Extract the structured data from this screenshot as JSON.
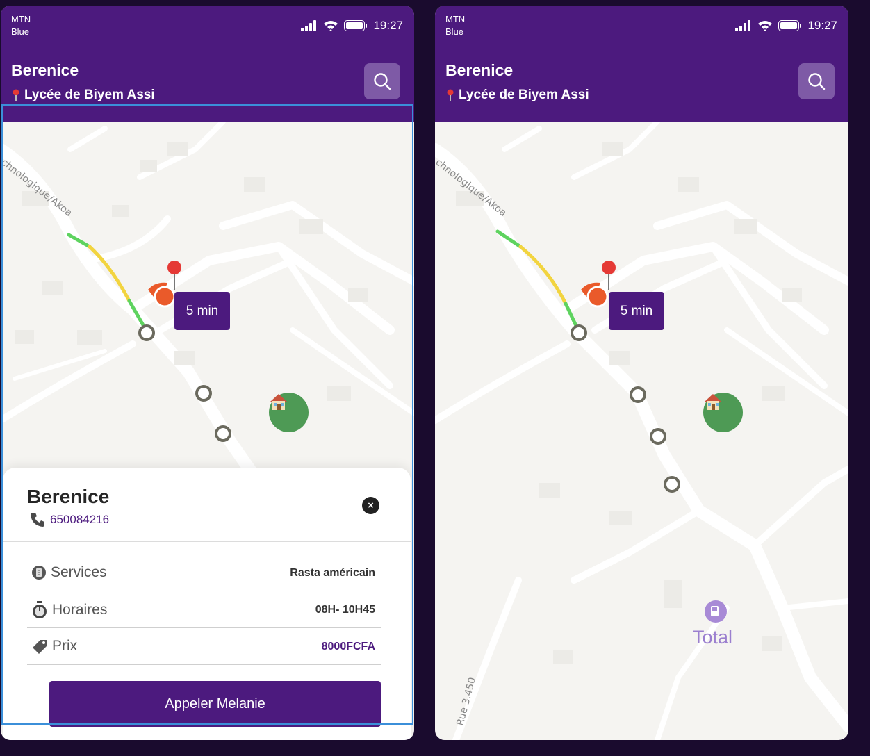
{
  "status_bar": {
    "carrier_line1": "MTN",
    "carrier_line2": "Blue",
    "time": "19:27"
  },
  "header": {
    "title": "Berenice",
    "location": "Lycée de Biyem Assi",
    "search_icon": "search-icon",
    "location_icon": "pushpin-icon"
  },
  "map": {
    "street_label": "chnologique/Akoa",
    "street_label_2": "Rue 3.450",
    "eta": "5 min",
    "poi_label": "Total",
    "poi_icon": "fuel-station-icon"
  },
  "sheet": {
    "name": "Berenice",
    "phone": "650084216",
    "rows": [
      {
        "label": "Services",
        "value": "Rasta américain",
        "icon": "services-icon"
      },
      {
        "label": "Horaires",
        "value": "08H- 10H45",
        "icon": "stopwatch-icon"
      },
      {
        "label": "Prix",
        "value": "8000FCFA",
        "icon": "price-tag-icon"
      }
    ],
    "call_button": "Appeler Melanie"
  },
  "colors": {
    "brand": "#4c1a7e",
    "route_green": "#5ed35f",
    "route_yellow": "#f2d43f",
    "home_marker": "#4e9a55",
    "origin_marker": "#ea5a2a"
  }
}
